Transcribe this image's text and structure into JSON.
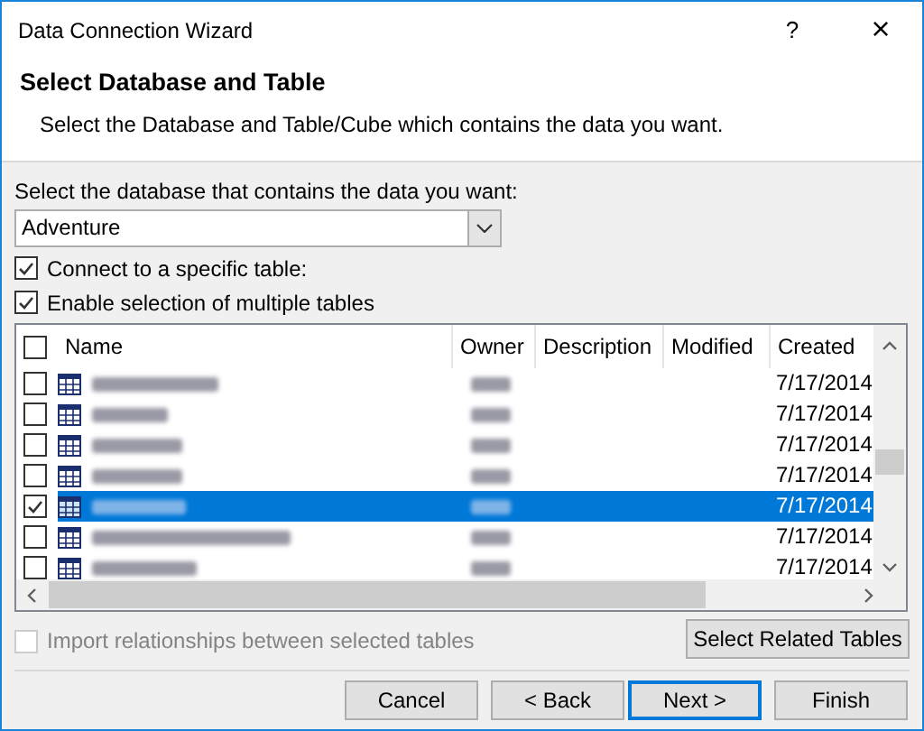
{
  "window": {
    "title": "Data Connection Wizard",
    "help": "?",
    "close": "×"
  },
  "header": {
    "title": "Select Database and Table",
    "subtitle": "Select the Database and Table/Cube which contains the data you want."
  },
  "database": {
    "label": "Select the database that contains the data you want:",
    "value": "Adventure"
  },
  "options": [
    {
      "label": "Connect to a specific table:",
      "checked": true,
      "disabled": false
    },
    {
      "label": "Enable selection of multiple tables",
      "checked": true,
      "disabled": false
    }
  ],
  "table": {
    "columns": [
      "Name",
      "Owner",
      "Description",
      "Modified",
      "Created"
    ],
    "all_checked": false,
    "rows": [
      {
        "checked": false,
        "selected": false,
        "created": "7/17/2014"
      },
      {
        "checked": false,
        "selected": false,
        "created": "7/17/2014"
      },
      {
        "checked": false,
        "selected": false,
        "created": "7/17/2014"
      },
      {
        "checked": false,
        "selected": false,
        "created": "7/17/2014"
      },
      {
        "checked": true,
        "selected": true,
        "created": "7/17/2014"
      },
      {
        "checked": false,
        "selected": false,
        "created": "7/17/2014"
      },
      {
        "checked": false,
        "selected": false,
        "created": "7/17/2014"
      }
    ]
  },
  "import_relationships": {
    "label": "Import relationships between selected tables",
    "checked": false,
    "disabled": true
  },
  "select_related": "Select Related Tables",
  "buttons": [
    {
      "label": "Cancel",
      "default": false
    },
    {
      "label": "< Back",
      "default": false
    },
    {
      "label": "Next >",
      "default": true
    },
    {
      "label": "Finish",
      "default": false
    }
  ]
}
